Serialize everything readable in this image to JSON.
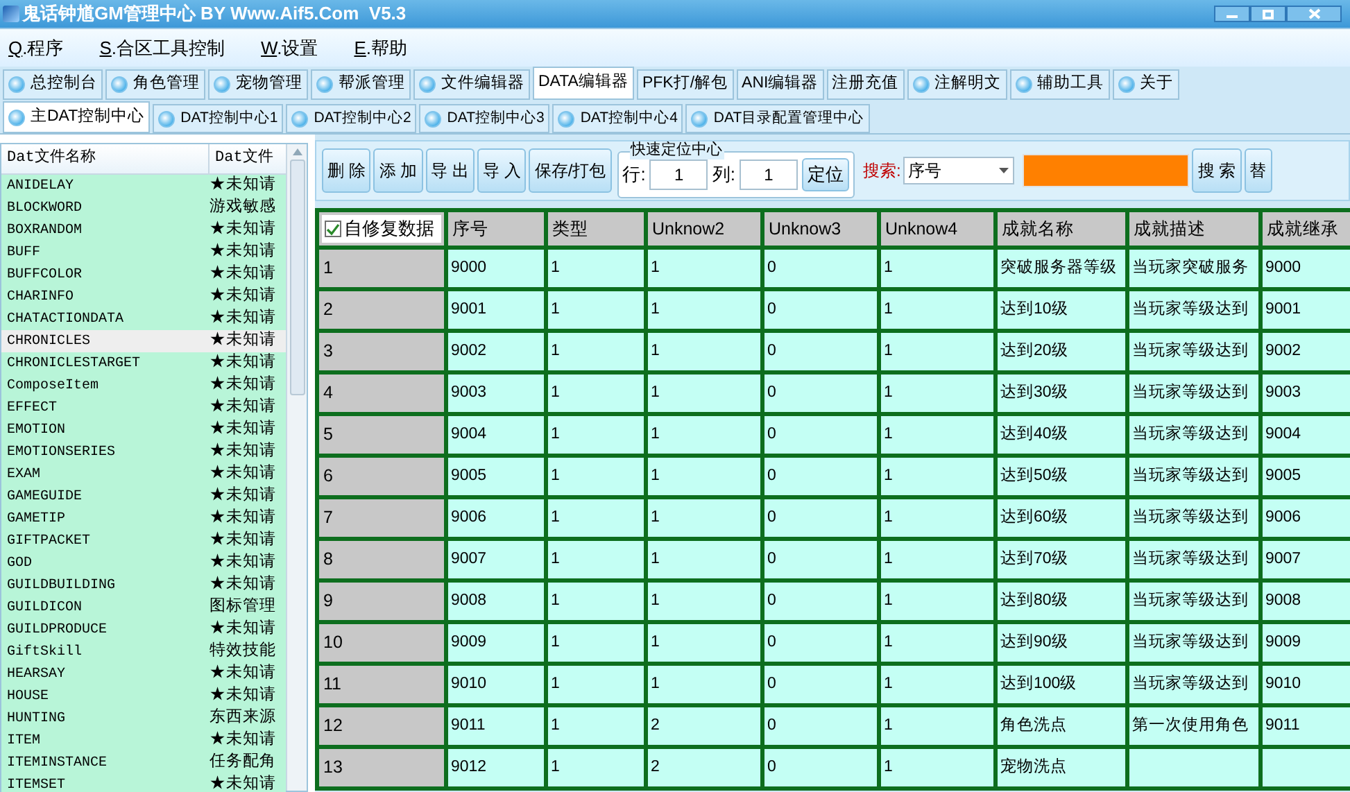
{
  "window": {
    "title": "鬼话钟馗GM管理中心 BY Www.Aif5.Com  V5.3"
  },
  "menu": [
    {
      "key": "Q",
      "label": ".程序"
    },
    {
      "key": "S",
      "label": ".合区工具控制"
    },
    {
      "key": "W",
      "label": ".设置"
    },
    {
      "key": "E",
      "label": ".帮助"
    }
  ],
  "tabs": [
    {
      "label": "总控制台",
      "has_icon": true,
      "selected": false
    },
    {
      "label": "角色管理",
      "has_icon": true,
      "selected": false
    },
    {
      "label": "宠物管理",
      "has_icon": true,
      "selected": false
    },
    {
      "label": "帮派管理",
      "has_icon": true,
      "selected": false
    },
    {
      "label": "文件编辑器",
      "has_icon": true,
      "selected": false
    },
    {
      "label": "DATA编辑器",
      "has_icon": false,
      "selected": true
    },
    {
      "label": "PFK打/解包",
      "has_icon": false,
      "selected": false
    },
    {
      "label": "ANI编辑器",
      "has_icon": false,
      "selected": false
    },
    {
      "label": "注册充值",
      "has_icon": false,
      "selected": false
    },
    {
      "label": "注解明文",
      "has_icon": true,
      "selected": false
    },
    {
      "label": "辅助工具",
      "has_icon": true,
      "selected": false
    },
    {
      "label": "关于",
      "has_icon": true,
      "selected": false
    }
  ],
  "subtabs": [
    {
      "label": "主DAT控制中心",
      "selected": true
    },
    {
      "label": "DAT控制中心1",
      "selected": false
    },
    {
      "label": "DAT控制中心2",
      "selected": false
    },
    {
      "label": "DAT控制中心3",
      "selected": false
    },
    {
      "label": "DAT控制中心4",
      "selected": false
    },
    {
      "label": "DAT目录配置管理中心",
      "selected": false
    }
  ],
  "file_list": {
    "columns": [
      "Dat文件名称",
      "Dat文件"
    ],
    "rows": [
      {
        "name": "ANIDELAY",
        "desc": "★未知请",
        "selected": false
      },
      {
        "name": "BLOCKWORD",
        "desc": "游戏敏感",
        "selected": false
      },
      {
        "name": "BOXRANDOM",
        "desc": "★未知请",
        "selected": false
      },
      {
        "name": "BUFF",
        "desc": "★未知请",
        "selected": false
      },
      {
        "name": "BUFFCOLOR",
        "desc": "★未知请",
        "selected": false
      },
      {
        "name": "CHARINFO",
        "desc": "★未知请",
        "selected": false
      },
      {
        "name": "CHATACTIONDATA",
        "desc": "★未知请",
        "selected": false
      },
      {
        "name": "CHRONICLES",
        "desc": "★未知请",
        "selected": true
      },
      {
        "name": "CHRONICLESTARGET",
        "desc": "★未知请",
        "selected": false
      },
      {
        "name": "ComposeItem",
        "desc": "★未知请",
        "selected": false
      },
      {
        "name": "EFFECT",
        "desc": "★未知请",
        "selected": false
      },
      {
        "name": "EMOTION",
        "desc": "★未知请",
        "selected": false
      },
      {
        "name": "EMOTIONSERIES",
        "desc": "★未知请",
        "selected": false
      },
      {
        "name": "EXAM",
        "desc": "★未知请",
        "selected": false
      },
      {
        "name": "GAMEGUIDE",
        "desc": "★未知请",
        "selected": false
      },
      {
        "name": "GAMETIP",
        "desc": "★未知请",
        "selected": false
      },
      {
        "name": "GIFTPACKET",
        "desc": "★未知请",
        "selected": false
      },
      {
        "name": "GOD",
        "desc": "★未知请",
        "selected": false
      },
      {
        "name": "GUILDBUILDING",
        "desc": "★未知请",
        "selected": false
      },
      {
        "name": "GUILDICON",
        "desc": "图标管理",
        "selected": false
      },
      {
        "name": "GUILDPRODUCE",
        "desc": "★未知请",
        "selected": false
      },
      {
        "name": "GiftSkill",
        "desc": "特效技能",
        "selected": false
      },
      {
        "name": "HEARSAY",
        "desc": "★未知请",
        "selected": false
      },
      {
        "name": "HOUSE",
        "desc": "★未知请",
        "selected": false
      },
      {
        "name": "HUNTING",
        "desc": "东西来源",
        "selected": false
      },
      {
        "name": "ITEM",
        "desc": "★未知请",
        "selected": false
      },
      {
        "name": "ITEMINSTANCE",
        "desc": "任务配角",
        "selected": false
      },
      {
        "name": "ITEMSET",
        "desc": "★未知请",
        "selected": false
      }
    ]
  },
  "toolbar": {
    "buttons": [
      "删 除",
      "添 加",
      "导 出",
      "导 入",
      "保存/打包"
    ],
    "locate": {
      "title": "快速定位中心",
      "row_label": "行:",
      "row_value": "1",
      "col_label": "列:",
      "col_value": "1",
      "button": "定位"
    },
    "search": {
      "label": "搜索:",
      "field": "序号",
      "buttons": [
        "搜 索",
        "替"
      ]
    }
  },
  "grid": {
    "auto_repair": {
      "label": "自修复数据",
      "checked": true
    },
    "columns": [
      "序号",
      "类型",
      "Unknow2",
      "Unknow3",
      "Unknow4",
      "成就名称",
      "成就描述",
      "成就继承"
    ],
    "rows": [
      {
        "index": "1",
        "cells": [
          "9000",
          "1",
          "1",
          "0",
          "1",
          "突破服务器等级",
          "当玩家突破服务",
          "9000"
        ]
      },
      {
        "index": "2",
        "cells": [
          "9001",
          "1",
          "1",
          "0",
          "1",
          "达到10级",
          "当玩家等级达到",
          "9001"
        ]
      },
      {
        "index": "3",
        "cells": [
          "9002",
          "1",
          "1",
          "0",
          "1",
          "达到20级",
          "当玩家等级达到",
          "9002"
        ]
      },
      {
        "index": "4",
        "cells": [
          "9003",
          "1",
          "1",
          "0",
          "1",
          "达到30级",
          "当玩家等级达到",
          "9003"
        ]
      },
      {
        "index": "5",
        "cells": [
          "9004",
          "1",
          "1",
          "0",
          "1",
          "达到40级",
          "当玩家等级达到",
          "9004"
        ]
      },
      {
        "index": "6",
        "cells": [
          "9005",
          "1",
          "1",
          "0",
          "1",
          "达到50级",
          "当玩家等级达到",
          "9005"
        ]
      },
      {
        "index": "7",
        "cells": [
          "9006",
          "1",
          "1",
          "0",
          "1",
          "达到60级",
          "当玩家等级达到",
          "9006"
        ]
      },
      {
        "index": "8",
        "cells": [
          "9007",
          "1",
          "1",
          "0",
          "1",
          "达到70级",
          "当玩家等级达到",
          "9007"
        ]
      },
      {
        "index": "9",
        "cells": [
          "9008",
          "1",
          "1",
          "0",
          "1",
          "达到80级",
          "当玩家等级达到",
          "9008"
        ]
      },
      {
        "index": "10",
        "cells": [
          "9009",
          "1",
          "1",
          "0",
          "1",
          "达到90级",
          "当玩家等级达到",
          "9009"
        ]
      },
      {
        "index": "11",
        "cells": [
          "9010",
          "1",
          "1",
          "0",
          "1",
          "达到100级",
          "当玩家等级达到",
          "9010"
        ]
      },
      {
        "index": "12",
        "cells": [
          "9011",
          "1",
          "2",
          "0",
          "1",
          "角色洗点",
          "第一次使用角色",
          "9011"
        ]
      },
      {
        "index": "13",
        "cells": [
          "9012",
          "1",
          "2",
          "0",
          "1",
          "宠物洗点"
        ]
      }
    ]
  }
}
